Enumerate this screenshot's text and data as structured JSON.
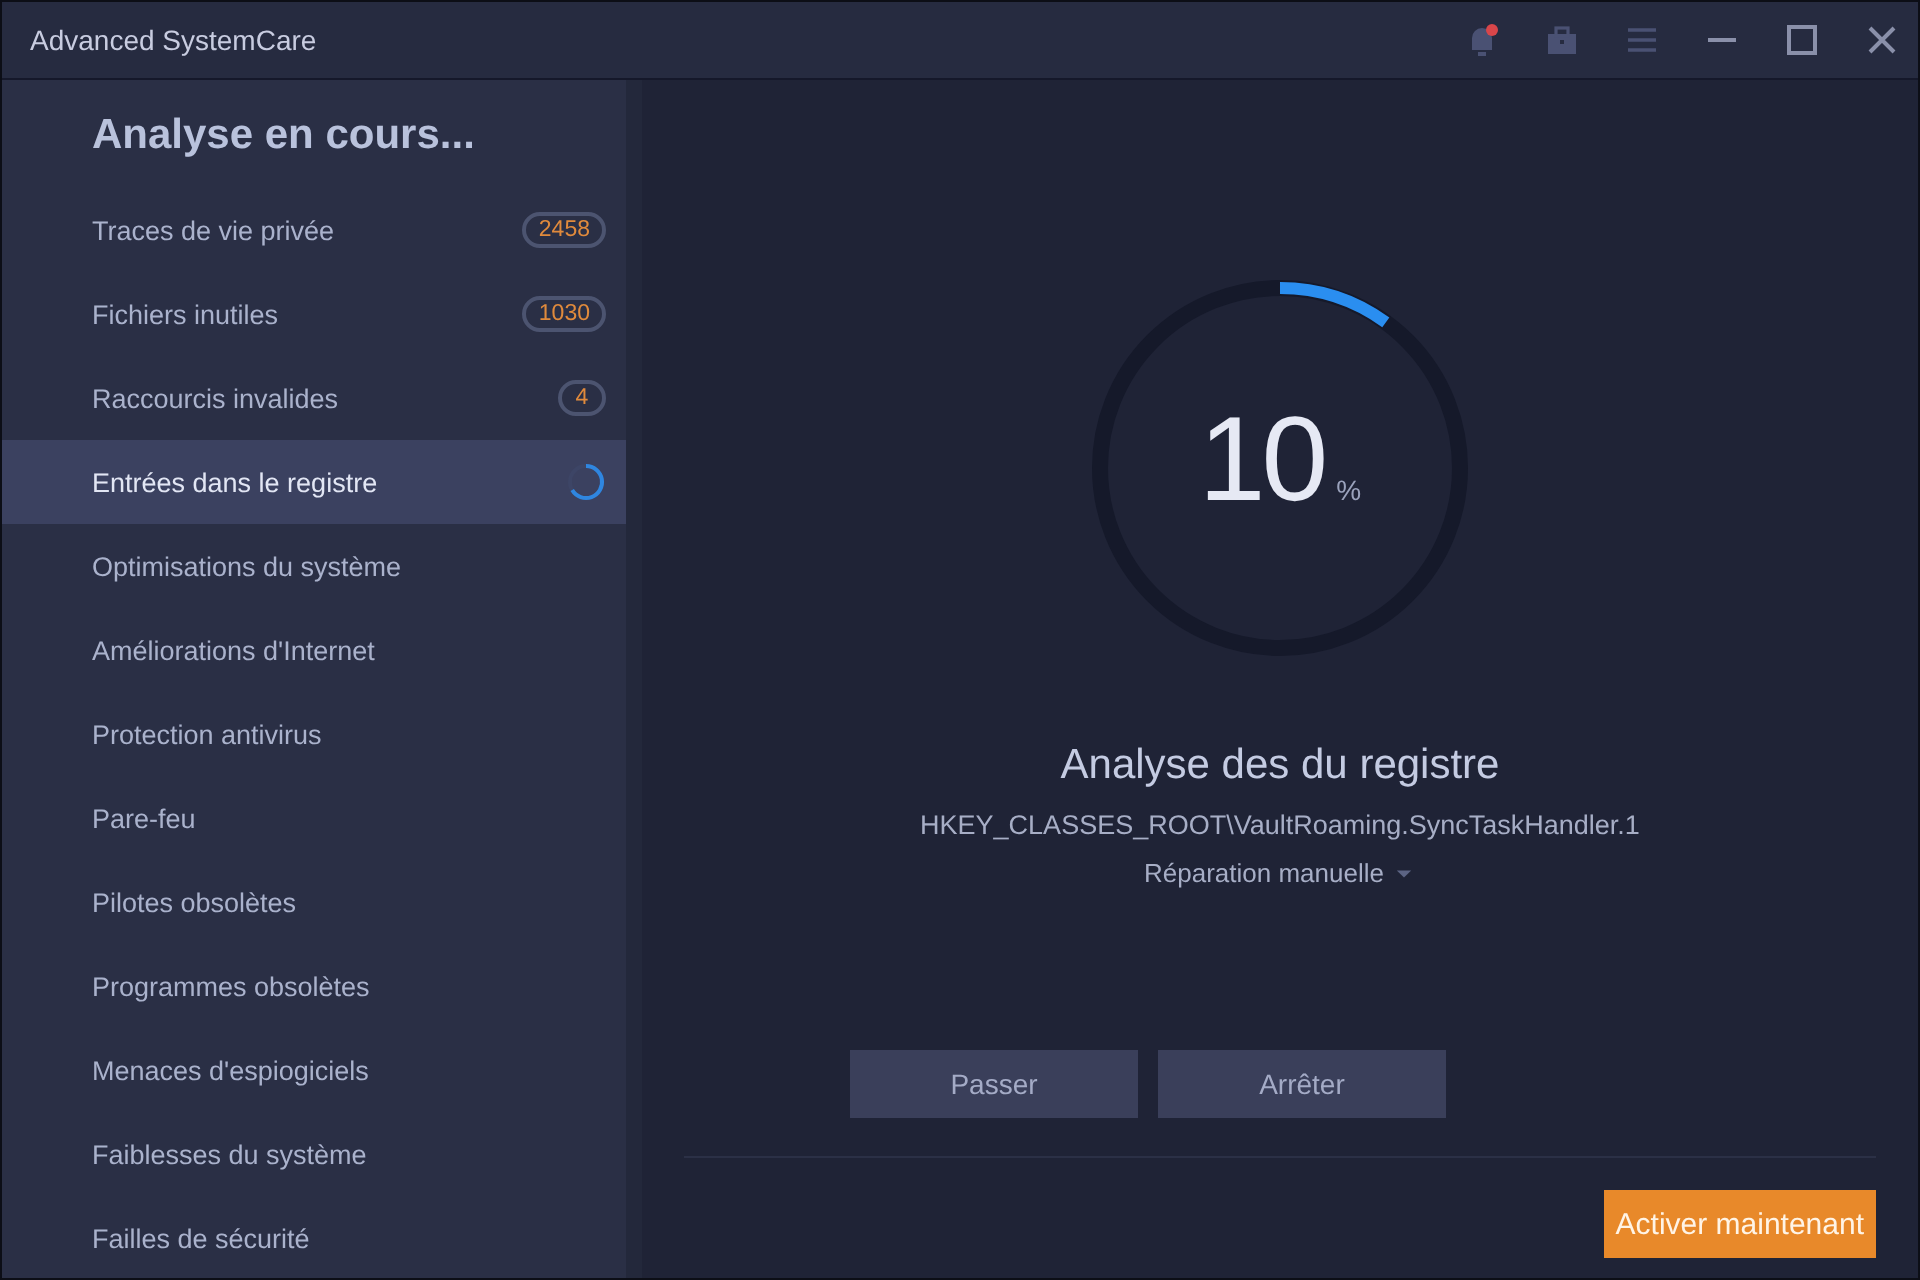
{
  "window": {
    "title": "Advanced SystemCare"
  },
  "sidebar": {
    "heading": "Analyse en cours...",
    "items": [
      {
        "label": "Traces de vie privée",
        "count": "2458",
        "selected": false,
        "scanning": false
      },
      {
        "label": "Fichiers inutiles",
        "count": "1030",
        "selected": false,
        "scanning": false
      },
      {
        "label": "Raccourcis invalides",
        "count": "4",
        "selected": false,
        "scanning": false
      },
      {
        "label": "Entrées dans le registre",
        "selected": true,
        "scanning": true
      },
      {
        "label": "Optimisations du système",
        "selected": false,
        "scanning": false
      },
      {
        "label": "Améliorations d'Internet",
        "selected": false,
        "scanning": false
      },
      {
        "label": "Protection antivirus",
        "selected": false,
        "scanning": false
      },
      {
        "label": "Pare-feu",
        "selected": false,
        "scanning": false
      },
      {
        "label": "Pilotes obsolètes",
        "selected": false,
        "scanning": false
      },
      {
        "label": "Programmes obsolètes",
        "selected": false,
        "scanning": false
      },
      {
        "label": "Menaces d'espiogiciels",
        "selected": false,
        "scanning": false
      },
      {
        "label": "Faiblesses du système",
        "selected": false,
        "scanning": false
      },
      {
        "label": "Failles de sécurité",
        "selected": false,
        "scanning": false
      }
    ]
  },
  "progress": {
    "level": 0.1,
    "value": "10",
    "unit": "%"
  },
  "scan": {
    "title": "Analyse des du registre",
    "path": "HKEY_CLASSES_ROOT\\VaultRoaming.SyncTaskHandler.1",
    "mode": "Réparation manuelle"
  },
  "buttons": [
    "Passer",
    "Arrêter"
  ],
  "activate_button": "Activer maintenant"
}
